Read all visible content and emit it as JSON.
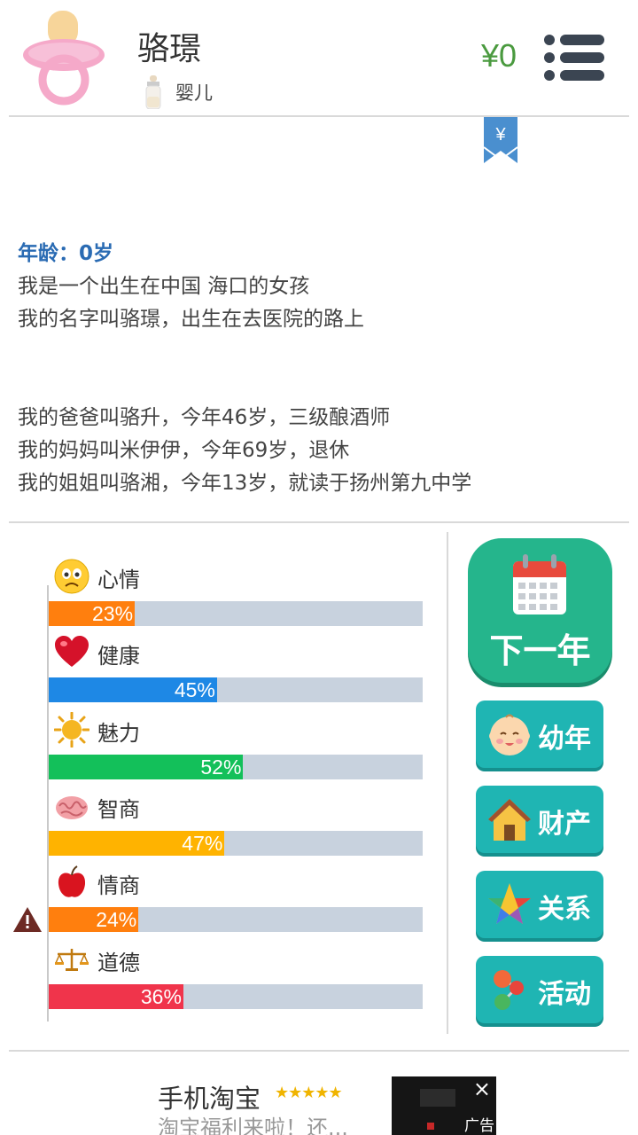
{
  "profile": {
    "name": "骆璟",
    "stage": "婴儿",
    "money": "¥0"
  },
  "story": {
    "age_line": "年龄：0岁",
    "paragraph1": [
      "我是一个出生在中国 海口的女孩",
      "我的名字叫骆璟，出生在去医院的路上"
    ],
    "paragraph2": [
      "我的爸爸叫骆升，今年46岁，三级酿酒师",
      "我的妈妈叫米伊伊，今年69岁，退休",
      "我的姐姐叫骆湘，今年13岁，就读于扬州第九中学"
    ],
    "bookmark_symbol": "¥"
  },
  "stats": [
    {
      "label": "心情",
      "value": 23,
      "text": "23%",
      "color": "#ff7f0e",
      "icon": "worried-face-icon"
    },
    {
      "label": "健康",
      "value": 45,
      "text": "45%",
      "color": "#1e88e5",
      "icon": "heart-icon"
    },
    {
      "label": "魅力",
      "value": 52,
      "text": "52%",
      "color": "#13c05a",
      "icon": "sun-icon"
    },
    {
      "label": "智商",
      "value": 47,
      "text": "47%",
      "color": "#ffb300",
      "icon": "brain-icon"
    },
    {
      "label": "情商",
      "value": 24,
      "text": "24%",
      "color": "#ff7f0e",
      "icon": "apple-icon",
      "warning": true
    },
    {
      "label": "道德",
      "value": 36,
      "text": "36%",
      "color": "#f0344b",
      "icon": "scales-icon"
    }
  ],
  "actions": {
    "next_year": "下一年",
    "childhood": "幼年",
    "assets": "财产",
    "relations": "关系",
    "activities": "活动"
  },
  "ad": {
    "title": "手机淘宝",
    "stars": "★★★★★",
    "subtitle": "淘宝福利来啦！还...",
    "close": "×",
    "tag": "广告"
  }
}
